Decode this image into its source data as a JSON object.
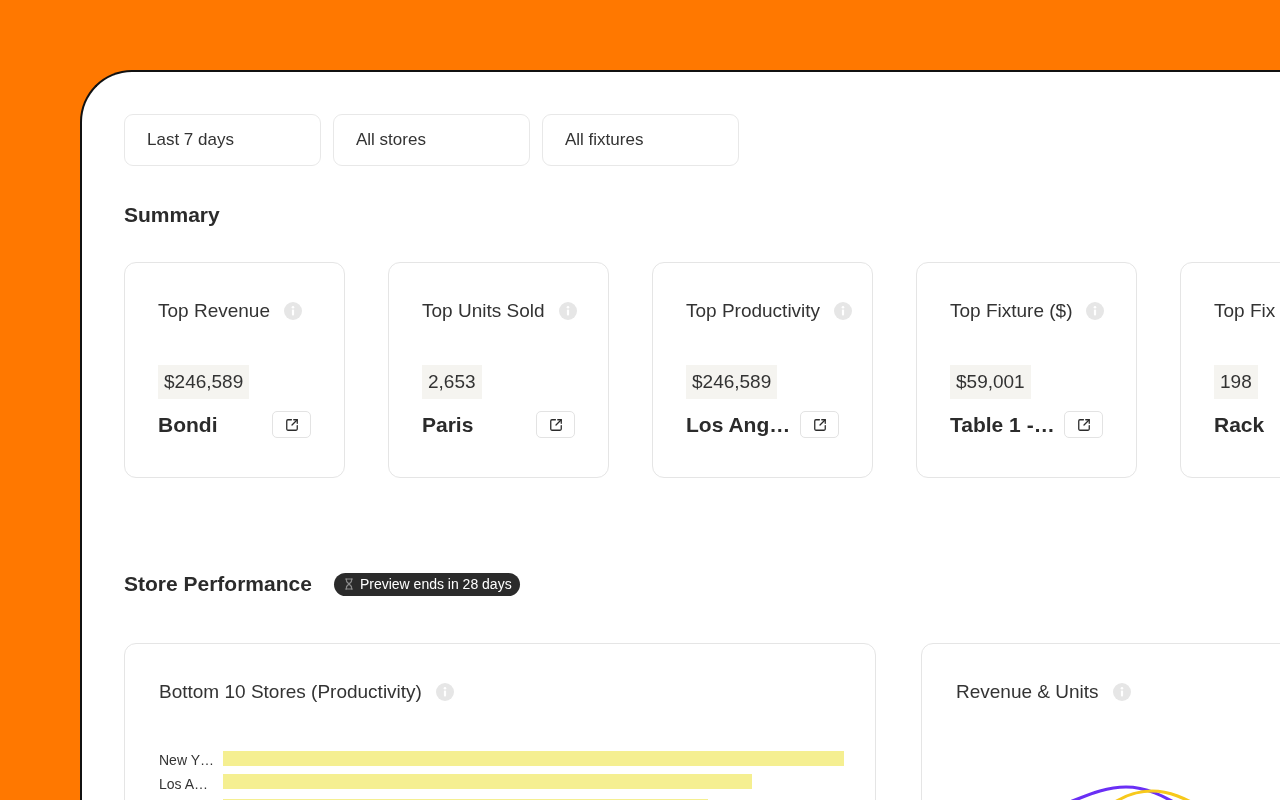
{
  "filters": [
    "Last 7 days",
    "All stores",
    "All fixtures"
  ],
  "summary": {
    "title": "Summary",
    "cards": [
      {
        "title": "Top Revenue",
        "info_icon": true,
        "value": "$246,589",
        "name": "Bondi",
        "link_button": true
      },
      {
        "title": "Top Units Sold",
        "info_icon": true,
        "value": "2,653",
        "name": "Paris",
        "link_button": true
      },
      {
        "title": "Top Productivity",
        "info_icon": true,
        "value": "$246,589",
        "name": "Los Ang…",
        "link_button": true
      },
      {
        "title": "Top Fixture ($)",
        "info_icon": true,
        "value": "$59,001",
        "name": "Table 1 -…",
        "link_button": true
      },
      {
        "title": "Top Fix",
        "info_icon": false,
        "value": "198",
        "name": "Rack",
        "link_button": false
      }
    ]
  },
  "store_performance": {
    "title": "Store Performance",
    "badge": "Preview ends in 28 days",
    "panels": [
      {
        "title": "Bottom 10 Stores (Productivity)",
        "info_icon": true,
        "kind": "bar",
        "bar_labels": [
          "New Y…",
          "Los A…"
        ]
      },
      {
        "title": "Revenue & Units",
        "info_icon": true,
        "kind": "line"
      }
    ]
  }
}
